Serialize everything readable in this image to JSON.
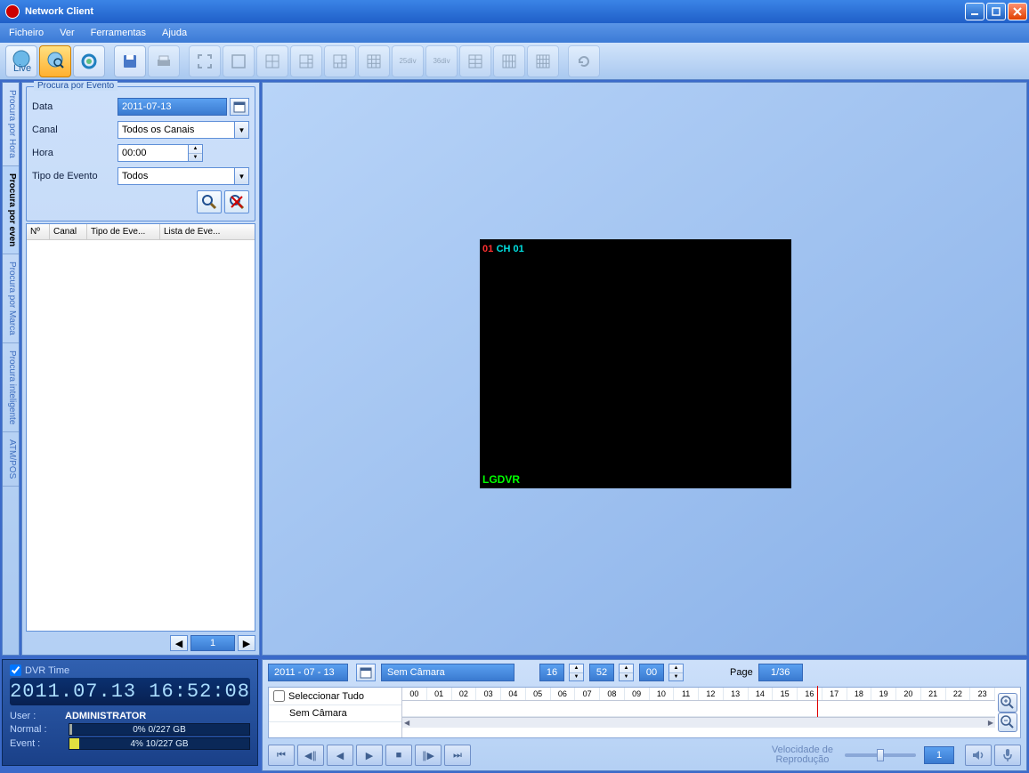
{
  "title": "Network Client",
  "menu": [
    "Ficheiro",
    "Ver",
    "Ferramentas",
    "Ajuda"
  ],
  "sidetabs": [
    "Procura por Hora",
    "Procura por even",
    "Procura por Marca",
    "Procura inteligente",
    "ATM/POS"
  ],
  "panel": {
    "legend": "Procura por Evento",
    "date_label": "Data",
    "date_value": "2011-07-13",
    "channel_label": "Canal",
    "channel_value": "Todos os Canais",
    "time_label": "Hora",
    "time_value": "00:00",
    "type_label": "Tipo de Evento",
    "type_value": "Todos",
    "cols": {
      "no": "Nº",
      "canal": "Canal",
      "tipo": "Tipo de Eve...",
      "lista": "Lista de Eve..."
    },
    "page": "1"
  },
  "video": {
    "ch_num": "01",
    "ch_name": "CH 01",
    "device": "LGDVR"
  },
  "status": {
    "dvrtime_label": "DVR Time",
    "datetime": "2011.07.13 16:52:08",
    "user_label": "User :",
    "user_value": "ADMINISTRATOR",
    "normal_label": "Normal :",
    "normal_text": "0% 0/227 GB",
    "event_label": "Event :",
    "event_text": "4% 10/227 GB"
  },
  "timeline": {
    "date": "2011 - 07 - 13",
    "camera": "Sem Câmara",
    "hh": "16",
    "mm": "52",
    "ss": "00",
    "page_label": "Page",
    "page_value": "1/36",
    "select_all": "Seleccionar Tudo",
    "no_camera": "Sem Câmara",
    "hours": [
      "00",
      "01",
      "02",
      "03",
      "04",
      "05",
      "06",
      "07",
      "08",
      "09",
      "10",
      "11",
      "12",
      "13",
      "14",
      "15",
      "16",
      "17",
      "18",
      "19",
      "20",
      "21",
      "22",
      "23"
    ]
  },
  "playback": {
    "speed_label1": "Velocidade de",
    "speed_label2": "Reprodução",
    "speed_value": "1"
  }
}
